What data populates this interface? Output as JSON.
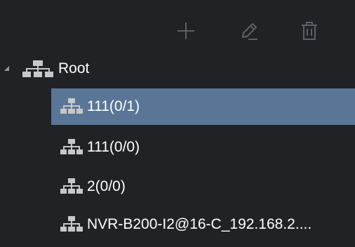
{
  "toolbar": {
    "buttons": [
      {
        "icon": "plus-icon"
      },
      {
        "icon": "pencil-icon"
      },
      {
        "icon": "trash-icon"
      }
    ],
    "icon_color": "#5d6066"
  },
  "tree": {
    "root": {
      "label": "Root",
      "expanded": true,
      "icon": "network-group-icon"
    },
    "children": [
      {
        "label": "111(0/1)",
        "selected": true,
        "icon": "network-group-icon"
      },
      {
        "label": "111(0/0)",
        "selected": false,
        "icon": "network-group-icon"
      },
      {
        "label": "2(0/0)",
        "selected": false,
        "icon": "network-group-icon"
      },
      {
        "label": "NVR-B200-I2@16-C_192.168.2....",
        "selected": false,
        "icon": "network-group-icon"
      }
    ]
  },
  "colors": {
    "background": "#202225",
    "selection": "#5a7696",
    "text": "#ffffff",
    "icon": "#c8c8c8"
  }
}
